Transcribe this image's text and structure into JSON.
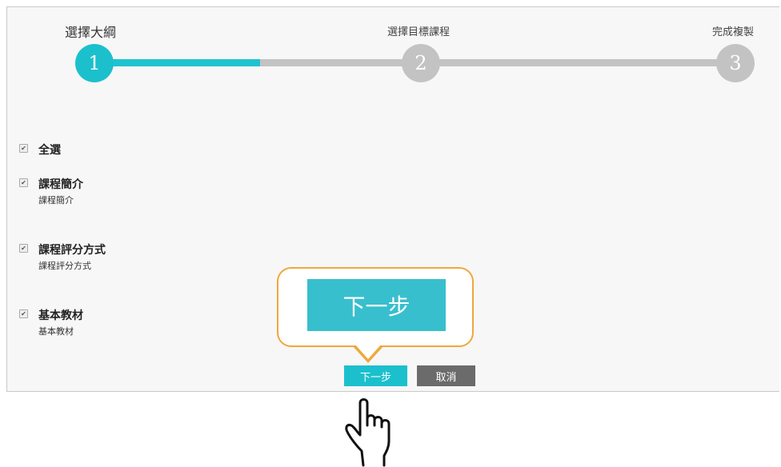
{
  "wizard": {
    "steps": [
      {
        "number": "1",
        "label": "選擇大綱"
      },
      {
        "number": "2",
        "label": "選擇目標課程"
      },
      {
        "number": "3",
        "label": "完成複製"
      }
    ],
    "current_step": 1,
    "progress_fraction": 0.25,
    "colors": {
      "active": "#1bc0cc",
      "inactive": "#c3c3c3",
      "callout_border": "#f0a83a"
    }
  },
  "options": {
    "select_all": {
      "title": "全選",
      "checked": true
    },
    "items": [
      {
        "title": "課程簡介",
        "desc": "課程簡介",
        "checked": true
      },
      {
        "title": "課程評分方式",
        "desc": "課程評分方式",
        "checked": true
      },
      {
        "title": "基本教材",
        "desc": "基本教材",
        "checked": true
      }
    ]
  },
  "callout": {
    "label": "下一步"
  },
  "buttons": {
    "next": "下一步",
    "cancel": "取消"
  },
  "icons": {
    "pointer": "hand-pointer-icon",
    "check": "✔"
  }
}
